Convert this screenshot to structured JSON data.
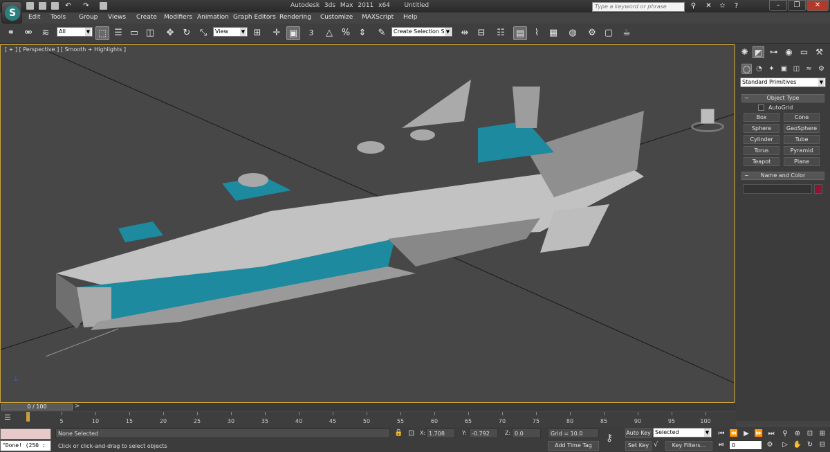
{
  "titlebar": {
    "app": "Autodesk 3ds Max  2011 x64",
    "doc": "Untitled",
    "search_placeholder": "Type a keyword or phrase",
    "logo_glyph": "S"
  },
  "menu": [
    "Edit",
    "Tools",
    "Group",
    "Views",
    "Create",
    "Modifiers",
    "Animation",
    "Graph Editors",
    "Rendering",
    "Customize",
    "MAXScript",
    "Help"
  ],
  "toolbar": {
    "filter": "All",
    "ref_coord": "View",
    "named_sel": "Create Selection Se",
    "snap_label": "3"
  },
  "viewport": {
    "label": "[ + ] [ Perspective ] [ Smooth + Highlights ]",
    "colors": {
      "hull": "#b9b9b9",
      "accent": "#1f8fa6",
      "dark": "#2f2f2f"
    }
  },
  "command_panel": {
    "category": "Standard Primitives",
    "object_type_title": "Object Type",
    "autogrid": "AutoGrid",
    "buttons": [
      "Box",
      "Cone",
      "Sphere",
      "GeoSphere",
      "Cylinder",
      "Tube",
      "Torus",
      "Pyramid",
      "Teapot",
      "Plane"
    ],
    "name_color_title": "Name and Color",
    "swatch_color": "#8a1537"
  },
  "timeline": {
    "slider": "0 / 100",
    "ticks": [
      "0",
      "5",
      "10",
      "15",
      "20",
      "25",
      "30",
      "35",
      "40",
      "45",
      "50",
      "55",
      "60",
      "65",
      "70",
      "75",
      "80",
      "85",
      "90",
      "95",
      "100"
    ]
  },
  "status": {
    "script_listener": "\"Done! (250 :",
    "selection": "None Selected",
    "prompt": "Click or click-and-drag to select objects",
    "x_label": "X:",
    "x": "1.708",
    "y_label": "Y:",
    "y": "-0.792",
    "z_label": "Z:",
    "z": "0.0",
    "grid": "Grid = 10.0",
    "add_time_tag": "Add Time Tag",
    "auto_key": "Auto Key",
    "set_key": "Set Key",
    "key_mode": "Selected",
    "key_filters": "Key Filters...",
    "frame": "0"
  }
}
